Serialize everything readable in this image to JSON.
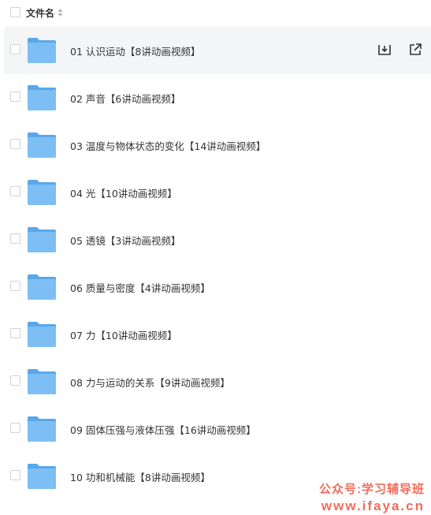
{
  "header": {
    "column_label": "文件名"
  },
  "files": [
    {
      "name": "01 认识运动【8讲动画视频】"
    },
    {
      "name": "02 声音【6讲动画视频】"
    },
    {
      "name": "03 温度与物体状态的变化【14讲动画视频】"
    },
    {
      "name": "04 光【10讲动画视频】"
    },
    {
      "name": "05 透镜【3讲动画视频】"
    },
    {
      "name": "06 质量与密度【4讲动画视频】"
    },
    {
      "name": "07 力【10讲动画视频】"
    },
    {
      "name": "08 力与运动的关系【9讲动画视频】"
    },
    {
      "name": "09 固体压强与液体压强【16讲动画视频】"
    },
    {
      "name": "10 功和机械能【8讲动画视频】"
    }
  ],
  "watermark": {
    "line1": "公众号:学习辅导班",
    "line2": "www.ifaya.cn"
  },
  "colors": {
    "folder": "#6cb4f0",
    "hover_row": "#f4f5f6",
    "watermark": "#f26b5b"
  }
}
